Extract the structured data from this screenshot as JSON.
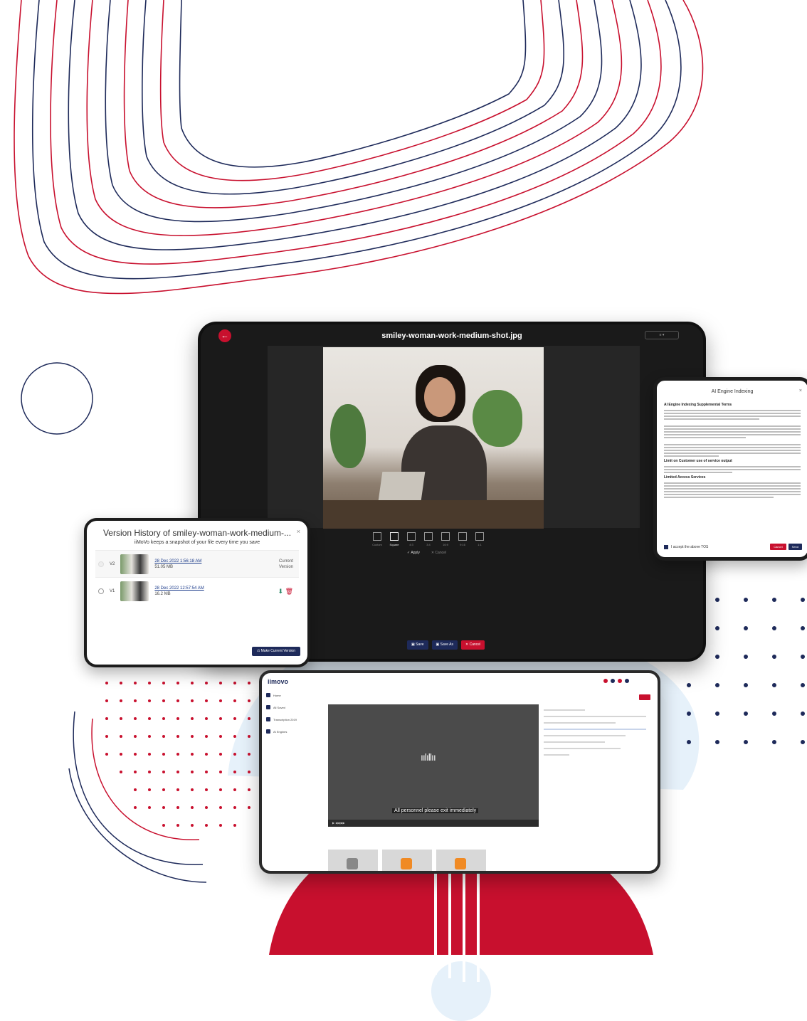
{
  "tablet": {
    "file_title": "smiley-woman-work-medium-shot.jpg",
    "crop_options": [
      "Custom",
      "Square",
      "4:3",
      "3:4",
      "16:9",
      "9:16",
      "1:1"
    ],
    "apply_label": "Apply",
    "cancel_crop_label": "Cancel",
    "save_label": "Save",
    "save_as_label": "Save As",
    "cancel_label": "Cancel"
  },
  "ai_modal": {
    "title": "AI Engine Indexing",
    "heading_terms": "AI Engine Indexing Supplemental Terms",
    "heading_limit": "Limit on Customer use of service output",
    "heading_limited": "Limited Access Services",
    "accept_label": "I accept the above TOS",
    "cancel_label": "Cancel",
    "send_label": "Send"
  },
  "version_history": {
    "title": "Version History of smiley-woman-work-medium-...",
    "subtitle": "iiMoVo keeps a snapshot of your file every time you save",
    "versions": [
      {
        "label": "V2",
        "date": "28 Dec 2022 1:56:18 AM",
        "size": "51.05 MB",
        "status_line1": "Current",
        "status_line2": "Version"
      },
      {
        "label": "V1",
        "date": "28 Dec 2022 12:57:54 AM",
        "size": "16.2 MB"
      }
    ],
    "make_current_label": "Make Current Version"
  },
  "laptop": {
    "logo": "iimovo",
    "nav": [
      "Home",
      "All Saved",
      "Transcription 2019",
      "AI Engines"
    ],
    "caption": "All personnel please exit immediately",
    "colors": {
      "red": "#c8102e",
      "navy": "#1e2a5a"
    }
  }
}
